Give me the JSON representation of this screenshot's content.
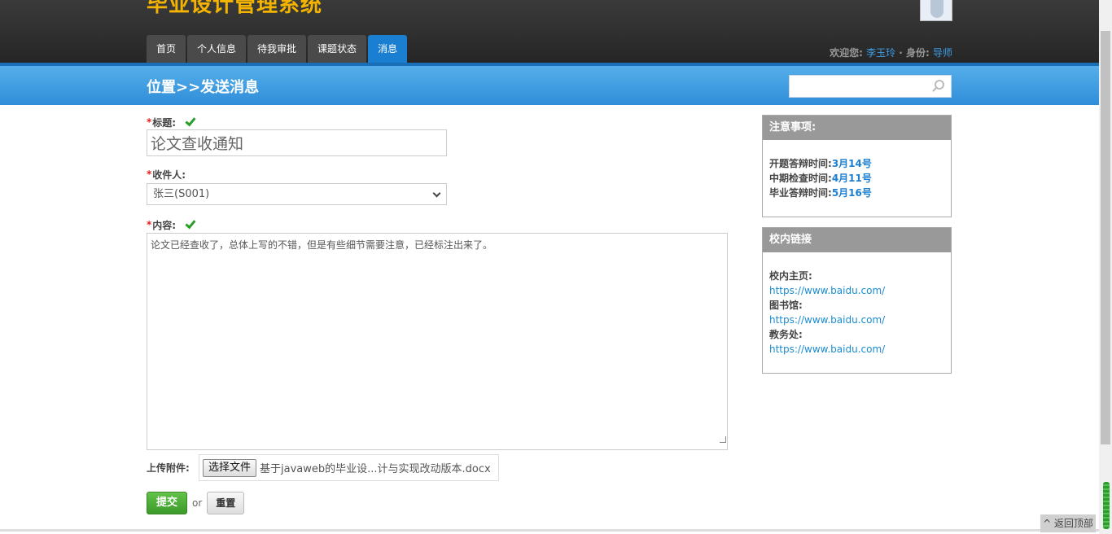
{
  "header": {
    "system_title": "毕业设计管理系统",
    "nav_tabs": [
      {
        "label": "首页",
        "active": false
      },
      {
        "label": "个人信息",
        "active": false
      },
      {
        "label": "待我审批",
        "active": false
      },
      {
        "label": "课题状态",
        "active": false
      },
      {
        "label": "消息",
        "active": true
      }
    ],
    "welcome_label": "欢迎您:",
    "user_name": "李玉玲",
    "role_sep": " · 身份:",
    "role": "导师"
  },
  "band": {
    "breadcrumb": "位置>>发送消息",
    "search_placeholder": ""
  },
  "form": {
    "required_mark": "*",
    "title_label": "标题:",
    "title_value": "论文查收通知",
    "recipient_label": "收件人:",
    "recipient_value": "张三(S001)",
    "content_label": "内容:",
    "content_value": "论文已经查收了，总体上写的不错，但是有些细节需要注意，已经标注出来了。",
    "attach_label": "上传附件:",
    "file_button": "选择文件",
    "file_name": "基于javaweb的毕业设...计与实现改动版本.docx",
    "submit_label": "提交",
    "or_text": "or",
    "reset_label": "重置"
  },
  "sidebar": {
    "notice_title": "注意事项:",
    "notice_items": [
      {
        "label": "开题答辩时间:",
        "value": "3月14号"
      },
      {
        "label": "中期检查时间:",
        "value": "4月11号"
      },
      {
        "label": "毕业答辩时间:",
        "value": "5月16号"
      }
    ],
    "links_title": "校内链接",
    "links": [
      {
        "label": "校内主页:",
        "url": "https://www.baidu.com/"
      },
      {
        "label": "图书馆:",
        "url": "https://www.baidu.com/"
      },
      {
        "label": "教务处:",
        "url": "https://www.baidu.com/"
      }
    ]
  },
  "footer": {
    "back_to_top": "^ 返回顶部"
  },
  "colors": {
    "accent_blue": "#1a7fd0",
    "logo_yellow": "#f5b400",
    "submit_green": "#3b9a2a"
  }
}
